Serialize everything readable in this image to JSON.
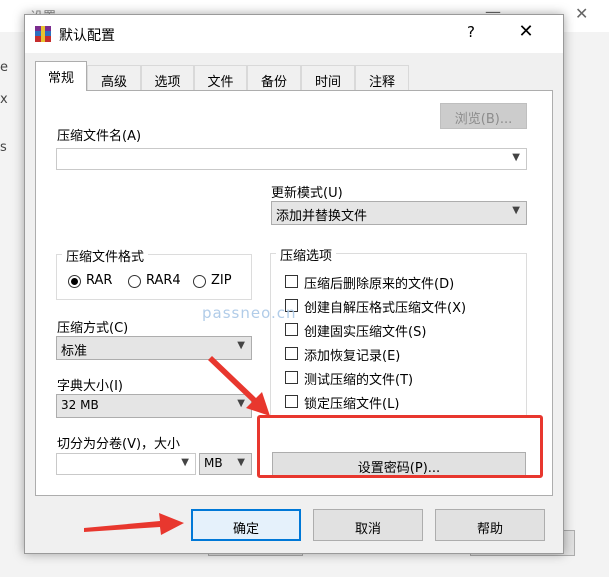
{
  "background": {
    "title_fragment": "设置",
    "edge_text_a": "e",
    "edge_text_b": "x",
    "edge_text_c": "s"
  },
  "dialog": {
    "title": "默认配置",
    "help_symbol": "?",
    "close_symbol": "✕",
    "tabs": [
      "常规",
      "高级",
      "选项",
      "文件",
      "备份",
      "时间",
      "注释"
    ],
    "active_tab": 0
  },
  "general": {
    "archive_name_label": "压缩文件名(A)",
    "archive_name_value": "",
    "browse_label": "浏览(B)...",
    "update_mode_label": "更新模式(U)",
    "update_mode_value": "添加并替换文件",
    "format_group": "压缩文件格式",
    "formats": [
      "RAR",
      "RAR4",
      "ZIP"
    ],
    "selected_format": "RAR",
    "method_label": "压缩方式(C)",
    "method_value": "标准",
    "dict_label": "字典大小(I)",
    "dict_value": "32 MB",
    "split_label": "切分为分卷(V)，大小",
    "split_value": "",
    "split_unit": "MB",
    "options_group": "压缩选项",
    "options": [
      {
        "label": "压缩后删除原来的文件(D)",
        "checked": false
      },
      {
        "label": "创建自解压格式压缩文件(X)",
        "checked": false
      },
      {
        "label": "创建固实压缩文件(S)",
        "checked": false
      },
      {
        "label": "添加恢复记录(E)",
        "checked": false
      },
      {
        "label": "测试压缩的文件(T)",
        "checked": false
      },
      {
        "label": "锁定压缩文件(L)",
        "checked": false
      }
    ],
    "password_button": "设置密码(P)..."
  },
  "footer": {
    "ok": "确定",
    "cancel": "取消",
    "help": "帮助"
  },
  "watermark": "passneo.cn",
  "colors": {
    "annotation": "#e8372e",
    "accent": "#0078d7"
  }
}
